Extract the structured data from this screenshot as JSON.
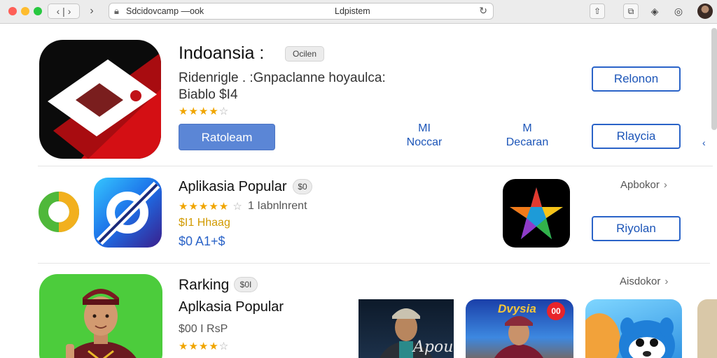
{
  "browser": {
    "site_text": "Sdcidovcamp —ook",
    "path_text": "Ldpistem",
    "nav_label": "‹ |  ›",
    "forward_label": "›"
  },
  "featured": {
    "name": "Indoansia :",
    "badge": "Ocilen",
    "developer": "Ridenrigle . :Gnpaclanne hoyaulca:",
    "price_line": "Biablo $I4",
    "rating_stars": 4,
    "get_button": "Ratoleam",
    "col1_line1": "MI",
    "col1_line2": "Noccar",
    "col2_line1": "M",
    "col2_line2": "Decaran",
    "right_button_1": "Relonon",
    "right_button_2": "Rlaycia"
  },
  "popular": {
    "heading": "Aplikasia Popular",
    "badge": "$0",
    "rating_stars": 5,
    "rating_text": "1 Iabnlnrent",
    "yellow_text": "$I1 Hhaag",
    "price": "$0 A1+$",
    "see_all": "Apbokor",
    "button": "Riyolan"
  },
  "ranking": {
    "heading": "Rarking",
    "badge": "$0I",
    "subheading": "Aplkasia Popular",
    "meta": "$00 I RsP",
    "rating_stars": 4,
    "see_all": "Aisdokor",
    "game1_text": "Apou",
    "game2_text": "Dvysia",
    "game2_badge": "00"
  },
  "colors": {
    "accent": "#2a63c8",
    "primary_button": "#5b86d6",
    "star": "#f0a500"
  },
  "icons": [
    "lock-icon",
    "reload-icon",
    "share-icon",
    "tabs-icon",
    "extension-icon",
    "sync-icon",
    "chevron-right-icon"
  ]
}
